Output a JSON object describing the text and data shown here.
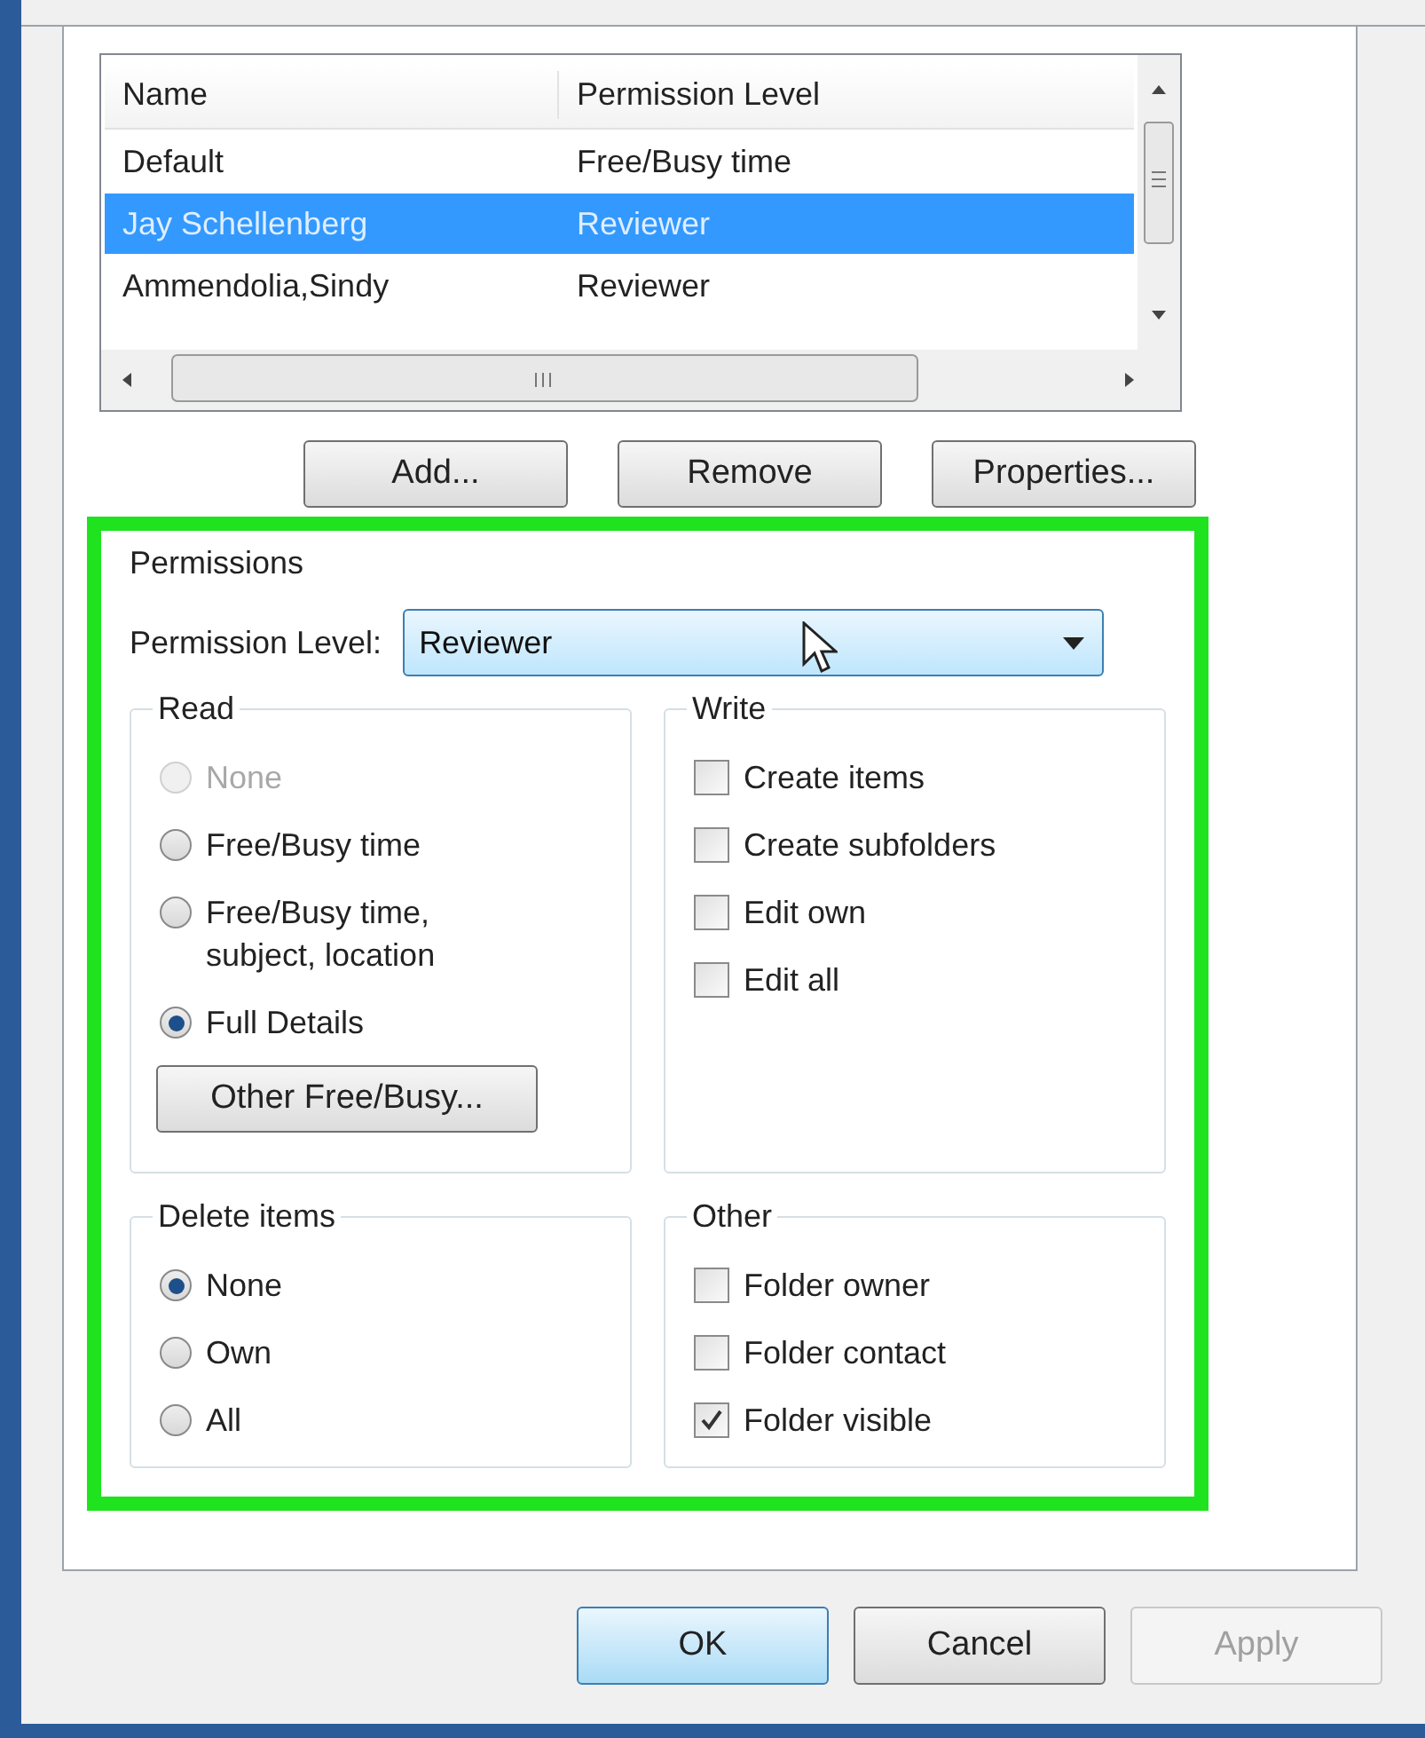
{
  "list": {
    "columns": [
      "Name",
      "Permission Level"
    ],
    "rows": [
      {
        "name": "Default",
        "level": "Free/Busy time",
        "selected": false
      },
      {
        "name": "Jay Schellenberg",
        "level": "Reviewer",
        "selected": true
      },
      {
        "name": "Ammendolia,Sindy",
        "level": "Reviewer",
        "selected": false
      }
    ]
  },
  "list_buttons": [
    "Add...",
    "Remove",
    "Properties..."
  ],
  "permissions": {
    "title": "Permissions",
    "level_label": "Permission Level:",
    "level_value": "Reviewer",
    "groups": [
      {
        "title": "Read",
        "kind": "radio",
        "items": [
          {
            "label": "None",
            "selected": false,
            "disabled": true
          },
          {
            "label": "Free/Busy time",
            "selected": false,
            "disabled": false
          },
          {
            "label": "Free/Busy time,\nsubject, location",
            "selected": false,
            "disabled": false
          },
          {
            "label": "Full Details",
            "selected": true,
            "disabled": false
          }
        ],
        "button": "Other Free/Busy..."
      },
      {
        "title": "Write",
        "kind": "checkbox",
        "items": [
          {
            "label": "Create items",
            "checked": false
          },
          {
            "label": "Create subfolders",
            "checked": false
          },
          {
            "label": "Edit own",
            "checked": false
          },
          {
            "label": "Edit all",
            "checked": false
          }
        ]
      },
      {
        "title": "Delete items",
        "kind": "radio",
        "items": [
          {
            "label": "None",
            "selected": true,
            "disabled": false
          },
          {
            "label": "Own",
            "selected": false,
            "disabled": false
          },
          {
            "label": "All",
            "selected": false,
            "disabled": false
          }
        ]
      },
      {
        "title": "Other",
        "kind": "checkbox",
        "items": [
          {
            "label": "Folder owner",
            "checked": false
          },
          {
            "label": "Folder contact",
            "checked": false
          },
          {
            "label": "Folder visible",
            "checked": true
          }
        ]
      }
    ]
  },
  "footer_buttons": [
    {
      "label": "OK",
      "default": true,
      "disabled": false
    },
    {
      "label": "Cancel",
      "default": false,
      "disabled": false
    },
    {
      "label": "Apply",
      "default": false,
      "disabled": true
    }
  ]
}
